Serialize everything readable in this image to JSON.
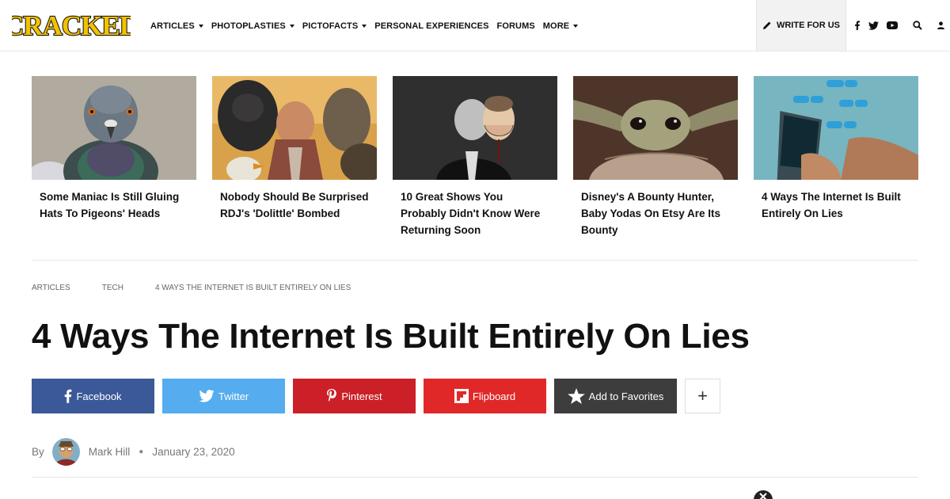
{
  "header": {
    "logo_text": "CRACKED",
    "nav": [
      {
        "label": "ARTICLES",
        "dropdown": true
      },
      {
        "label": "PHOTOPLASTIES",
        "dropdown": true
      },
      {
        "label": "PICTOFACTS",
        "dropdown": true
      },
      {
        "label": "PERSONAL EXPERIENCES",
        "dropdown": false
      },
      {
        "label": "FORUMS",
        "dropdown": false
      },
      {
        "label": "MORE",
        "dropdown": true
      }
    ],
    "write_label": "WRITE FOR US",
    "icons": [
      "pencil-icon",
      "facebook-icon",
      "twitter-icon",
      "youtube-icon",
      "search-icon",
      "user-icon"
    ]
  },
  "featured": [
    {
      "title": "Some Maniac Is Still Gluing Hats To Pigeons' Heads",
      "image": "pigeon"
    },
    {
      "title": "Nobody Should Be Surprised RDJ's 'Dolittle' Bombed",
      "image": "dolittle"
    },
    {
      "title": "10 Great Shows You Probably Didn't Know Were Returning Soon",
      "image": "saul"
    },
    {
      "title": "Disney's A Bounty Hunter, Baby Yodas On Etsy Are Its Bounty",
      "image": "baby-yoda"
    },
    {
      "title": "4 Ways The Internet Is Built Entirely On Lies",
      "image": "phone-likes"
    }
  ],
  "breadcrumb": [
    "ARTICLES",
    "TECH",
    "4 WAYS THE INTERNET IS BUILT ENTIRELY ON LIES"
  ],
  "article": {
    "title": "4 Ways The Internet Is Built Entirely On Lies",
    "author_prefix": "By",
    "author": "Mark Hill",
    "date": "January 23, 2020"
  },
  "share": [
    {
      "label": "Facebook",
      "color": "#3b5998",
      "icon": "facebook-icon"
    },
    {
      "label": "Twitter",
      "color": "#55acee",
      "icon": "twitter-icon"
    },
    {
      "label": "Pinterest",
      "color": "#cb2027",
      "icon": "pinterest-icon"
    },
    {
      "label": "Flipboard",
      "color": "#e12828",
      "icon": "flipboard-icon"
    },
    {
      "label": "Add to Favorites",
      "color": "#3d3d3d",
      "icon": "star-icon"
    }
  ],
  "share_more": "+",
  "colors": {
    "logo_fill": "#f2c200",
    "logo_stroke": "#1a1a1a",
    "divider": "#e6e6e6"
  }
}
